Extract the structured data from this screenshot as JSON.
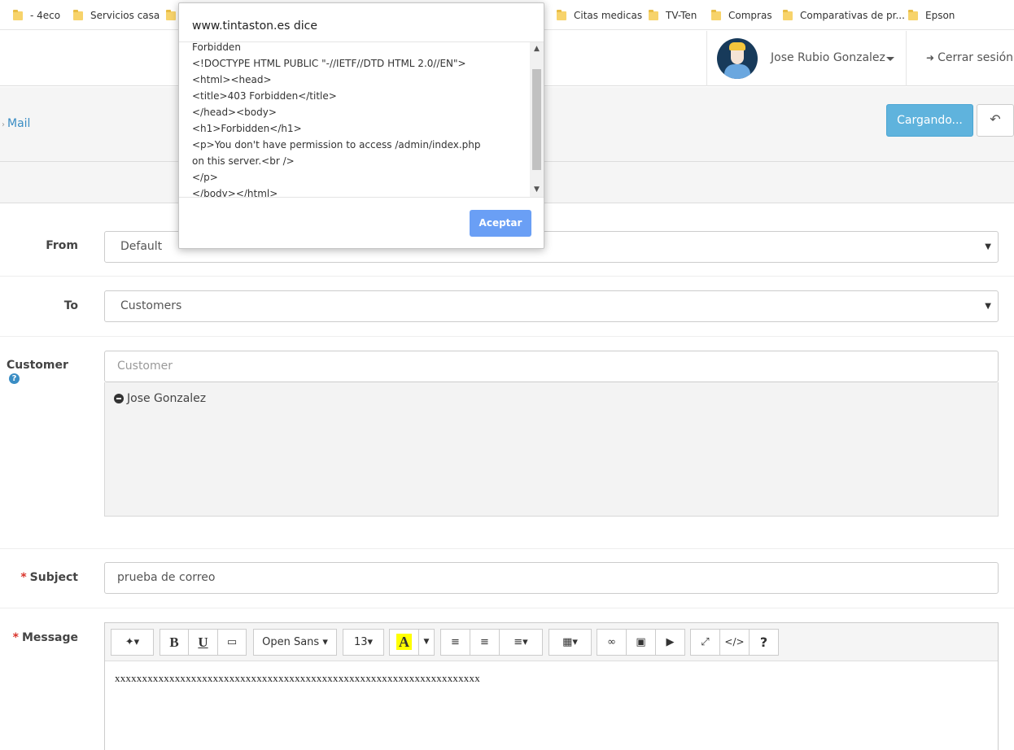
{
  "bookmarks": [
    {
      "label": "- 4eco"
    },
    {
      "label": "Servicios casa"
    },
    {
      "label": ""
    },
    {
      "label": "Citas medicas"
    },
    {
      "label": "TV-Ten"
    },
    {
      "label": "Compras"
    },
    {
      "label": "Comparativas de pr..."
    },
    {
      "label": "Epson"
    }
  ],
  "header": {
    "user_name": "Jose Rubio Gonzalez",
    "logout_label": "Cerrar sesión",
    "logout_icon": "sign-out-icon"
  },
  "breadcrumb": {
    "label": "Mail"
  },
  "actions": {
    "loading_label": "Cargando...",
    "back_icon": "undo-icon"
  },
  "form": {
    "from": {
      "label": "From",
      "value": "Default"
    },
    "to": {
      "label": "To",
      "value": "Customers"
    },
    "customer": {
      "label": "Customer",
      "placeholder": "Customer",
      "selected": [
        "Jose Gonzalez"
      ]
    },
    "subject": {
      "label": "Subject",
      "value": "prueba de correo"
    },
    "message": {
      "label": "Message",
      "body": "xxxxxxxxxxxxxxxxxxxxxxxxxxxxxxxxxxxxxxxxxxxxxxxxxxxxxxxxxxxxxxxxxxx"
    }
  },
  "editor_toolbar": {
    "font_name": "Open Sans",
    "font_size": "13",
    "bold": "B",
    "underline": "U",
    "highlight": "A",
    "help": "?"
  },
  "dialog": {
    "title": "www.tintaston.es dice",
    "lines": [
      "Forbidden",
      "<!DOCTYPE HTML PUBLIC \"-//IETF//DTD HTML 2.0//EN\">",
      "<html><head>",
      "<title>403 Forbidden</title>",
      "</head><body>",
      "<h1>Forbidden</h1>",
      "<p>You don't have permission to access /admin/index.php",
      "on this server.<br />",
      "</p>",
      "</body></html>"
    ],
    "ok_label": "Aceptar"
  },
  "colors": {
    "primary": "#5fb3dd",
    "link": "#3a8dc4",
    "required": "#d9342b",
    "dialog_button": "#6a9ff5"
  }
}
